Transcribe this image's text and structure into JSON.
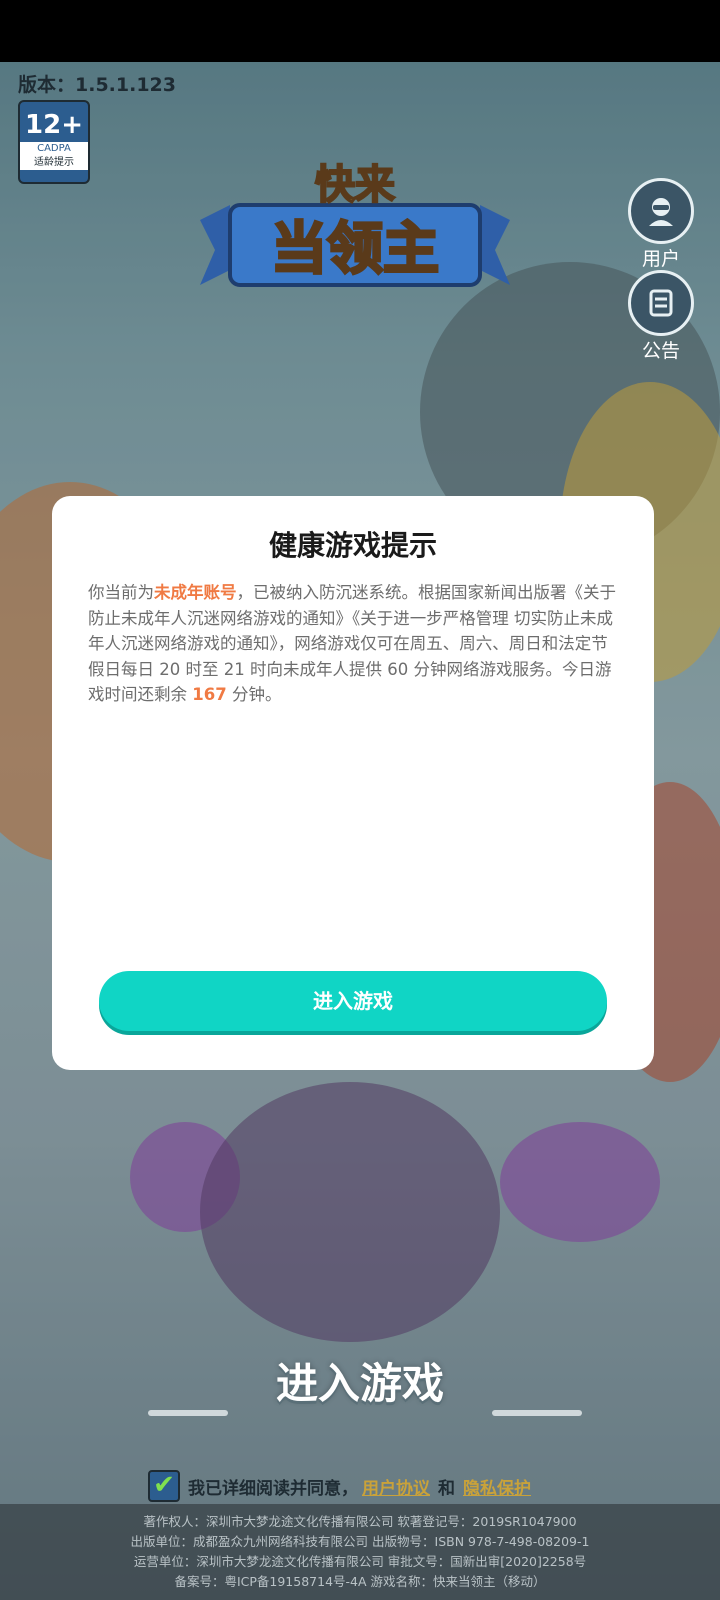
{
  "header": {
    "version": "版本：1.5.1.123"
  },
  "age_badge": {
    "rating": "12+",
    "org": "CADPA",
    "tip": "适龄提示"
  },
  "logo": {
    "line1": "快来",
    "line2": "当领主"
  },
  "side_buttons": [
    {
      "label": "用户",
      "icon": "user-icon"
    },
    {
      "label": "公告",
      "icon": "notice-icon"
    }
  ],
  "dialog": {
    "title": "健康游戏提示",
    "body_pre": "你当前为",
    "body_hl1": "未成年账号",
    "body_mid": "，已被纳入防沉迷系统。根据国家新闻出版署《关于防止未成年人沉迷网络游戏的通知》《关于进一步严格管理 切实防止未成年人沉迷网络游戏的通知》，网络游戏仅可在周五、周六、周日和法定节假日每日 20 时至 21 时向未成年人提供 60 分钟网络游戏服务。今日游戏时间还剩余 ",
    "body_hl2": "167",
    "body_post": " 分钟。",
    "enter_button": "进入游戏"
  },
  "main": {
    "enter_label": "进入游戏"
  },
  "agreement": {
    "check_mark": "✔",
    "text": "我已详细阅读并同意，",
    "user_agreement": "用户协议",
    "and": "和",
    "privacy_policy": "隐私保护"
  },
  "footer": {
    "line1": "著作权人：深圳市大梦龙途文化传播有限公司  软著登记号：2019SR1047900",
    "line2": "出版单位：成都盈众九州网络科技有限公司  出版物号：ISBN 978-7-498-08209-1",
    "line3": "运营单位：深圳市大梦龙途文化传播有限公司  审批文号：国新出审[2020]2258号",
    "line4": "备案号：粤ICP备19158714号-4A  游戏名称：快来当领主（移动）"
  },
  "colors": {
    "accent": "#10d5c5",
    "highlight": "#f07a43",
    "link": "#c9a23a"
  }
}
